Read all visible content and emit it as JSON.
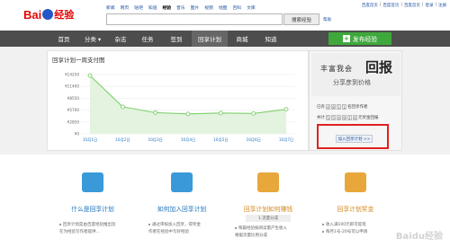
{
  "top_links": [
    "百度首页",
    "百度首页",
    "百度首页",
    "登录",
    "注册"
  ],
  "logo": {
    "bai": "Bai",
    "jy": "经验"
  },
  "nav": [
    "新闻",
    "网页",
    "贴吧",
    "知道",
    "经验",
    "音乐",
    "图片",
    "视频",
    "地图",
    "百科",
    "文库"
  ],
  "nav_active_index": 4,
  "search": {
    "button": "搜索经验",
    "help": "帮助",
    "placeholder": ""
  },
  "menu": [
    {
      "label": "首页"
    },
    {
      "label": "分类 ▾"
    },
    {
      "label": "杂志"
    },
    {
      "label": "任务"
    },
    {
      "label": "签到"
    },
    {
      "label": "回享计划"
    },
    {
      "label": "商城"
    },
    {
      "label": "知道"
    }
  ],
  "menu_active_index": 5,
  "publish": {
    "label": "发布经验",
    "plus": "+"
  },
  "chart_title": "回享计划一周支付图",
  "chart_data": {
    "type": "area",
    "categories": [
      "10月1日",
      "10月2日",
      "10月3日",
      "10月4日",
      "10月5日",
      "10月6日",
      "10月7日"
    ],
    "values": [
      14000,
      6500,
      5100,
      4800,
      5000,
      4900,
      5900
    ],
    "yticks": [
      "¥14250",
      "¥11400",
      "¥8550",
      "¥5700",
      "¥2850",
      "¥0"
    ],
    "ylim": [
      0,
      14250
    ],
    "title": "回享计划一周支付图",
    "color": "#7fd06e"
  },
  "side": {
    "banner_line1": "丰富我会",
    "banner_big": "回报",
    "banner_line2": "分享彦到价格",
    "stat1_label": "已有",
    "stat1_digits": [
      "4",
      "8",
      "1",
      "1"
    ],
    "stat1_suffix": "名回享作者",
    "stat2_label": "共计",
    "stat2_digits": [
      "5",
      "5",
      "4",
      "9",
      "1",
      "6"
    ],
    "stat2_suffix": "元奖金回报",
    "join": "加入回享计划 >>"
  },
  "cards": [
    {
      "title": "什么是回享计划",
      "sub": "",
      "lines": [
        "回享计划是由百度经验推出旨",
        "在为经验写作者提供..."
      ],
      "color": "#3a9ad9"
    },
    {
      "title": "如何加入回享计划",
      "sub": "",
      "lines": [
        "通过审核加入回享，得奖金",
        "作者在经验中写好经验"
      ],
      "color": "#3a9ad9"
    },
    {
      "title": "回享计划如何赚钱",
      "sub": "1.流量分成",
      "lines": [
        "每篇经验按阅读量产生收入",
        "根据流量比例分成"
      ],
      "color": "#e8a73b"
    },
    {
      "title": "回享计划奖金",
      "sub": "",
      "lines": [
        "收入满100元即可提现",
        "每月1号-20号可以申请"
      ],
      "color": "#e8a73b"
    }
  ],
  "watermark": "Baidu经验"
}
